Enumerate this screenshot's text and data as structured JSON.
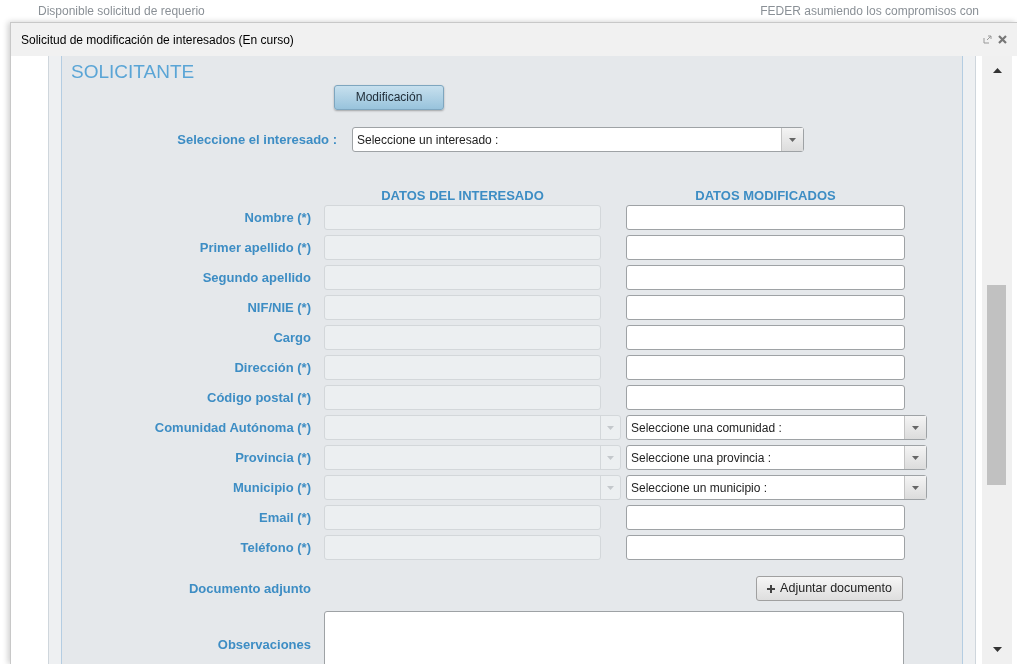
{
  "background_texts": [
    "Disponible solicitud de requerio",
    "FEDER asumiendo los compromisos con"
  ],
  "window": {
    "title": "Solicitud de modificación de interesados (En curso)"
  },
  "section": {
    "title": "SOLICITANTE",
    "mode_button": "Modificación",
    "selector": {
      "label": "Seleccione el interesado :",
      "value": "Seleccione un interesado :"
    },
    "columns": [
      "DATOS DEL INTERESADO",
      "DATOS MODIFICADOS"
    ],
    "fields": [
      {
        "label": "Nombre (*)",
        "kind": "text"
      },
      {
        "label": "Primer apellido (*)",
        "kind": "text"
      },
      {
        "label": "Segundo apellido",
        "kind": "text"
      },
      {
        "label": "NIF/NIE (*)",
        "kind": "text"
      },
      {
        "label": "Cargo",
        "kind": "text"
      },
      {
        "label": "Dirección (*)",
        "kind": "text"
      },
      {
        "label": "Código postal (*)",
        "kind": "text"
      },
      {
        "label": "Comunidad Autónoma (*)",
        "kind": "select",
        "value": "Seleccione una comunidad :"
      },
      {
        "label": "Provincia (*)",
        "kind": "select",
        "value": "Seleccione una provincia :"
      },
      {
        "label": "Municipio (*)",
        "kind": "select",
        "value": "Seleccione un municipio :"
      },
      {
        "label": "Email (*)",
        "kind": "text"
      },
      {
        "label": "Teléfono (*)",
        "kind": "text"
      }
    ],
    "attachment": {
      "label": "Documento adjunto",
      "button": "Adjuntar documento"
    },
    "notes": {
      "label": "Observaciones"
    }
  }
}
